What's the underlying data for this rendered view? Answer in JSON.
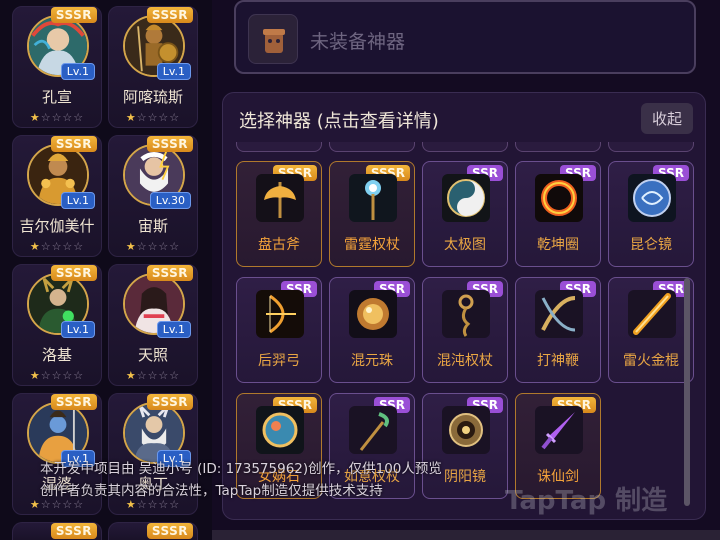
{
  "heroes": [
    {
      "name": "孔宣",
      "rarity": "SSSR",
      "level": "Lv.1",
      "stars": 1
    },
    {
      "name": "阿喀琉斯",
      "rarity": "SSSR",
      "level": "Lv.1",
      "stars": 1
    },
    {
      "name": "吉尔伽美什",
      "rarity": "SSSR",
      "level": "Lv.1",
      "stars": 1
    },
    {
      "name": "宙斯",
      "rarity": "SSSR",
      "level": "Lv.30",
      "stars": 1
    },
    {
      "name": "洛基",
      "rarity": "SSSR",
      "level": "Lv.1",
      "stars": 1
    },
    {
      "name": "天照",
      "rarity": "SSSR",
      "level": "Lv.1",
      "stars": 1
    },
    {
      "name": "湿婆",
      "rarity": "SSSR",
      "level": "Lv.1",
      "stars": 1
    },
    {
      "name": "奥丁",
      "rarity": "SSSR",
      "level": "Lv.1",
      "stars": 1
    }
  ],
  "equip_slot": {
    "placeholder": "未装备神器"
  },
  "picker": {
    "title": "选择神器 (点击查看详情)",
    "collapse_label": "收起",
    "artifacts": [
      {
        "name": "盘古斧",
        "rarity": "SSSR",
        "icon": "axe-icon"
      },
      {
        "name": "雷霆权杖",
        "rarity": "SSSR",
        "icon": "thunder-scepter-icon"
      },
      {
        "name": "太极图",
        "rarity": "SSR",
        "icon": "taiji-icon"
      },
      {
        "name": "乾坤圈",
        "rarity": "SSR",
        "icon": "fire-ring-icon"
      },
      {
        "name": "昆仑镜",
        "rarity": "SSR",
        "icon": "mirror-icon"
      },
      {
        "name": "后羿弓",
        "rarity": "SSR",
        "icon": "bow-icon"
      },
      {
        "name": "混元珠",
        "rarity": "SSR",
        "icon": "orb-icon"
      },
      {
        "name": "混沌权杖",
        "rarity": "SSR",
        "icon": "chaos-staff-icon"
      },
      {
        "name": "打神鞭",
        "rarity": "SSR",
        "icon": "whip-icon"
      },
      {
        "name": "雷火金棍",
        "rarity": "SSR",
        "icon": "golden-staff-icon"
      },
      {
        "name": "女娲石",
        "rarity": "SSSR",
        "icon": "stone-icon"
      },
      {
        "name": "如意权杖",
        "rarity": "SSR",
        "icon": "ruyi-staff-icon"
      },
      {
        "name": "阴阳镜",
        "rarity": "SSR",
        "icon": "yinyang-mirror-icon"
      },
      {
        "name": "诛仙剑",
        "rarity": "SSSR",
        "icon": "sword-icon"
      }
    ]
  },
  "notice": {
    "line1": "本开发中项目由 吴迪小号 (ID: 173575962)创作，仅供100人预览",
    "line2": "创作者负责其内容的合法性，TapTap制造仅提供技术支持"
  },
  "watermark": "TapTap 制造",
  "colors": {
    "sssr": "#e9a22f",
    "ssr": "#9a4fd6",
    "level_badge": "#2a5fc4",
    "star": "#f2c14a"
  }
}
